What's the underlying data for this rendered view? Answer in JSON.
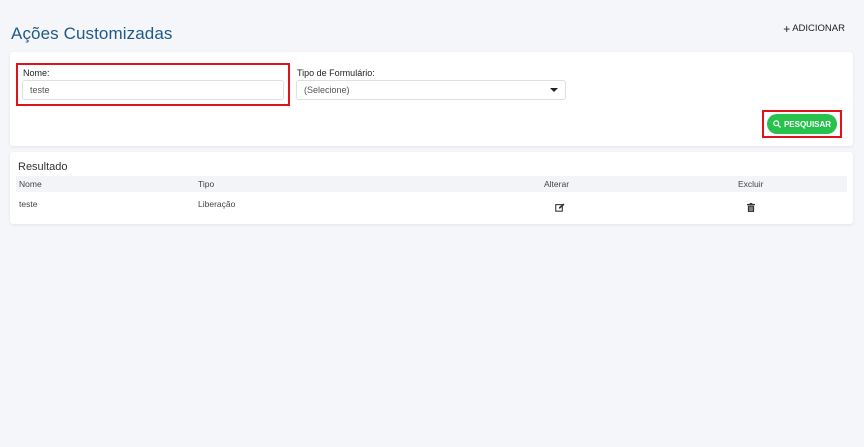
{
  "page": {
    "title": "Ações Customizadas"
  },
  "header": {
    "add_label": "ADICIONAR",
    "add_icon": "plus-icon"
  },
  "filters": {
    "nome": {
      "label": "Nome:",
      "value": "teste"
    },
    "tipo": {
      "label": "Tipo de Formulário:",
      "value": "(Selecione)"
    },
    "search_label": "PESQUISAR",
    "search_icon": "search-icon"
  },
  "results": {
    "title": "Resultado",
    "columns": [
      "Nome",
      "Tipo",
      "Alterar",
      "Excluir"
    ],
    "rows": [
      {
        "nome": "teste",
        "tipo": "Liberação",
        "edit_icon": "edit-icon",
        "delete_icon": "trash-icon"
      }
    ]
  },
  "colors": {
    "title": "#1f5a86",
    "accent_green": "#27c24c",
    "highlight_red": "#e0131b",
    "background": "#f5f6fa"
  }
}
